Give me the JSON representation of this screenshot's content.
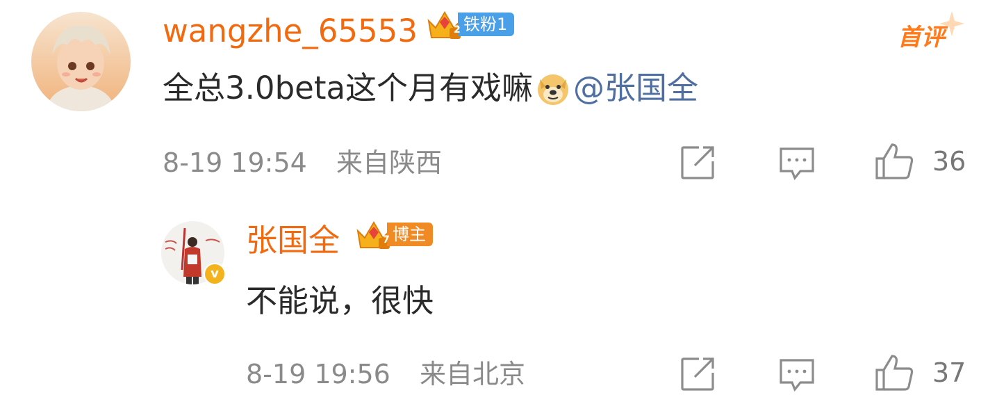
{
  "comment": {
    "username": "wangzhe_65553",
    "badge": {
      "level": "2",
      "label": "铁粉1",
      "color": "#4aa0e8"
    },
    "first_tag": "首评",
    "text": "全总3.0beta这个月有戏嘛",
    "emoji": "doge-icon",
    "mention": "@张国全",
    "time": "8-19 19:54",
    "location": "来自陕西",
    "likes": "36"
  },
  "reply": {
    "username": "张国全",
    "badge": {
      "level": "7",
      "label": "博主",
      "color": "#f08a24"
    },
    "verified": "v",
    "text": "不能说，很快",
    "time": "8-19 19:56",
    "location": "来自北京",
    "likes": "37"
  },
  "colors": {
    "username": "#f26a0f",
    "mention": "#4f6fa3",
    "meta": "#8a8a8a"
  }
}
